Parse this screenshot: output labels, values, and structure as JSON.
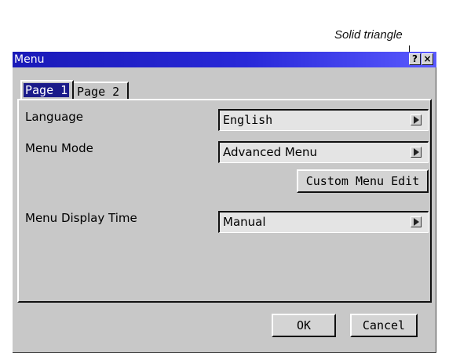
{
  "annotation": {
    "text": "Solid triangle"
  },
  "window": {
    "title": "Menu",
    "help_glyph": "?",
    "close_glyph": "×"
  },
  "tabs": [
    {
      "label": "Page 1",
      "selected": true
    },
    {
      "label": "Page 2",
      "selected": false
    }
  ],
  "settings": {
    "language": {
      "label": "Language",
      "value": "English"
    },
    "menu_mode": {
      "label": "Menu Mode",
      "value": "Advanced Menu"
    },
    "custom_menu_edit": {
      "label": "Custom Menu Edit"
    },
    "menu_display_time": {
      "label": "Menu Display Time",
      "value": "Manual"
    }
  },
  "footer": {
    "ok_label": "OK",
    "cancel_label": "Cancel"
  },
  "colors": {
    "titlebar_start": "#1a1ab8",
    "titlebar_end": "#5a5aff",
    "window_bg": "#c8c8c8",
    "selected_tab_bg": "#1a1a8a"
  }
}
